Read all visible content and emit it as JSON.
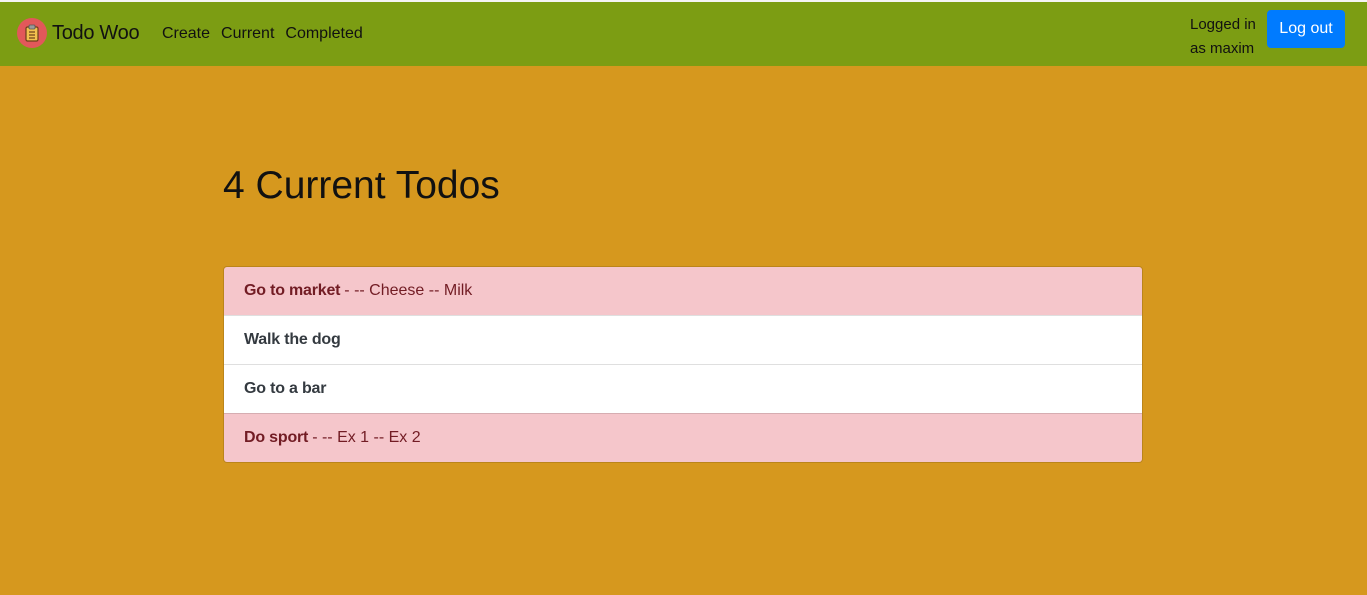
{
  "navbar": {
    "brand": "Todo Woo",
    "logo_icon": "clipboard-icon",
    "links": [
      "Create",
      "Current",
      "Completed"
    ],
    "user_text": "Logged in as maxim",
    "logout_label": "Log out",
    "background": "#7c9d13",
    "logout_color": "#007bff"
  },
  "main": {
    "title": "4 Current Todos",
    "background": "#d6981e"
  },
  "todos": [
    {
      "title": "Go to market",
      "memo": "- -- Cheese -- Milk",
      "important": true
    },
    {
      "title": "Walk the dog",
      "memo": "",
      "important": false
    },
    {
      "title": "Go to a bar",
      "memo": "",
      "important": false
    },
    {
      "title": "Do sport",
      "memo": "- -- Ex 1 -- Ex 2",
      "important": true
    }
  ]
}
